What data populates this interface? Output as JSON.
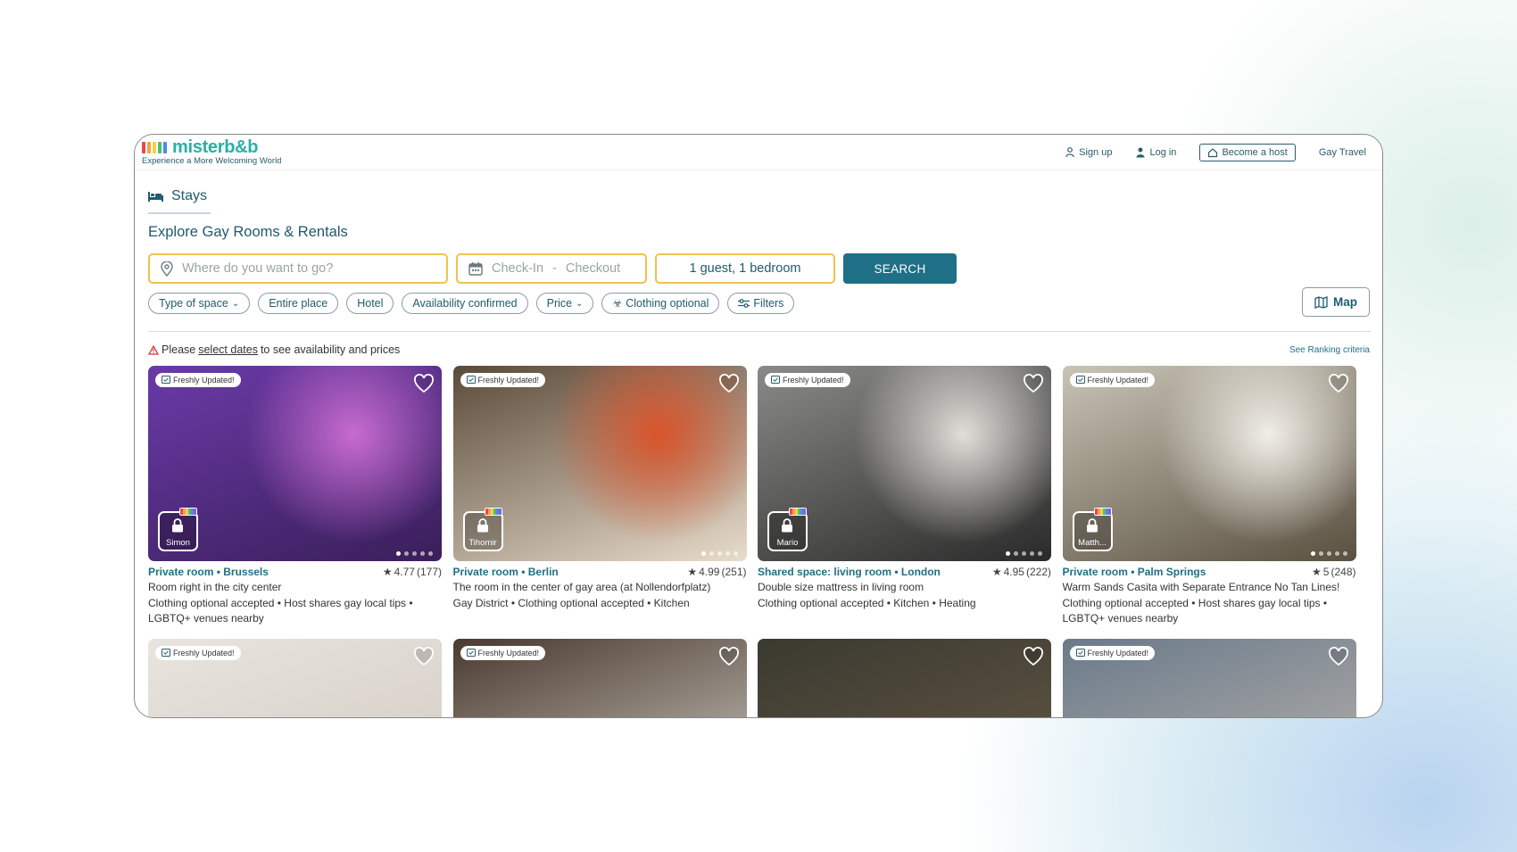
{
  "brand": {
    "name": "misterb&b",
    "tagline": "Experience a More Welcoming World",
    "bar_colors": [
      "#e8484f",
      "#f4a14b",
      "#f4d04b",
      "#4bbf73",
      "#4b8be8",
      "#8b5be8"
    ]
  },
  "nav": {
    "signup": "Sign up",
    "login": "Log in",
    "host": "Become a host",
    "travel": "Gay Travel"
  },
  "section": {
    "stays": "Stays",
    "title": "Explore Gay Rooms & Rentals"
  },
  "search": {
    "where_placeholder": "Where do you want to go?",
    "checkin": "Check-In",
    "sep": "-",
    "checkout": "Checkout",
    "guests": "1 guest, 1 bedroom",
    "button": "SEARCH"
  },
  "filters": [
    "Type of space",
    "Entire place",
    "Hotel",
    "Availability confirmed",
    "Price",
    "Clothing optional",
    "Filters"
  ],
  "map_label": "Map",
  "notice": {
    "pre": "Please",
    "link": "select dates",
    "post": "to see availability and prices"
  },
  "ranking": "See Ranking criteria",
  "fresh_label": "Freshly Updated!",
  "listings": [
    {
      "type": "Private room • Brussels",
      "rating": "4.77",
      "reviews": "(177)",
      "title": "Room right in the city center",
      "features": "Clothing optional accepted • Host shares gay local tips • LGBTQ+ venues nearby",
      "host": "Simon",
      "colors": [
        "#6a3aa8",
        "#c86bd0",
        "#3a1f5a"
      ]
    },
    {
      "type": "Private room • Berlin",
      "rating": "4.99",
      "reviews": "(251)",
      "title": "The room in the center of gay area (at Nollendorfplatz)",
      "features": "Gay District • Clothing optional accepted • Kitchen",
      "host": "Tihomir",
      "colors": [
        "#5a4a3a",
        "#d9542a",
        "#e8dccb"
      ]
    },
    {
      "type": "Shared space: living room • London",
      "rating": "4.95",
      "reviews": "(222)",
      "title": "Double size mattress in living room",
      "features": "Clothing optional accepted • Kitchen • Heating",
      "host": "Mario",
      "colors": [
        "#8a8a88",
        "#e0ded8",
        "#2a2a2a"
      ]
    },
    {
      "type": "Private room • Palm Springs",
      "rating": "5",
      "reviews": "(248)",
      "title": "Warm Sands Casita with Separate Entrance No Tan Lines!",
      "features": "Clothing optional accepted • Host shares gay local tips • LGBTQ+ venues nearby",
      "host": "Matth...",
      "colors": [
        "#c8c4b6",
        "#f0eee8",
        "#5a5040"
      ]
    }
  ],
  "second_row_colors": [
    [
      "#e8e4de",
      "#d0c8c0"
    ],
    [
      "#4a3a30",
      "#d8d4cc"
    ],
    [
      "#3a3a30",
      "#6a5a48"
    ],
    [
      "#6a7a8a",
      "#c0b8b0"
    ]
  ]
}
